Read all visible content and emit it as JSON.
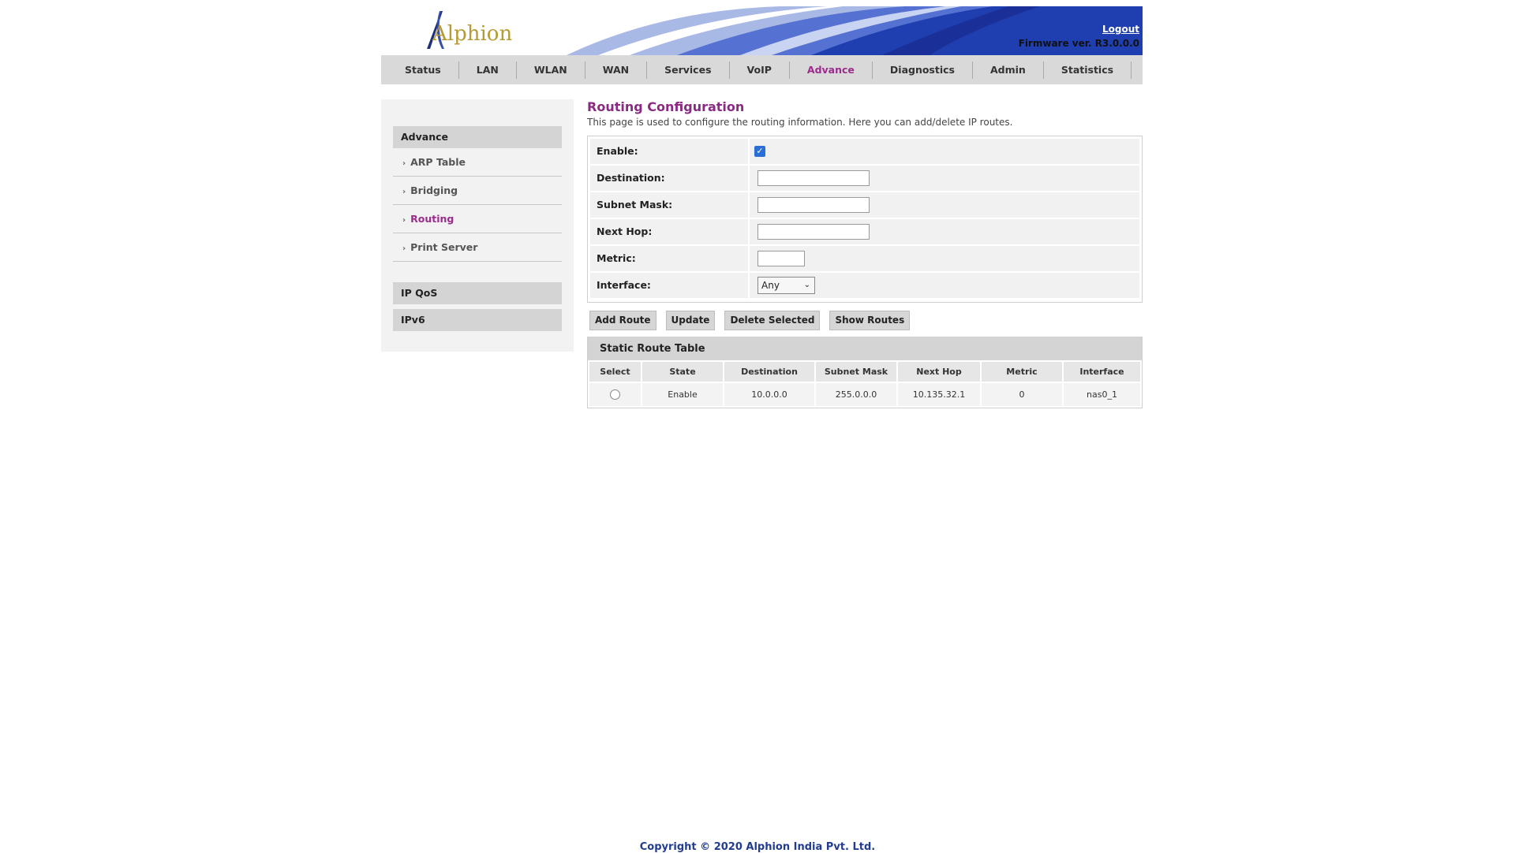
{
  "header": {
    "logo_text": "Alphion",
    "logout_label": "Logout",
    "firmware": "Firmware ver. R3.0.0.0"
  },
  "topnav": [
    {
      "label": "Status"
    },
    {
      "label": "LAN"
    },
    {
      "label": "WLAN"
    },
    {
      "label": "WAN"
    },
    {
      "label": "Services"
    },
    {
      "label": "VoIP"
    },
    {
      "label": "Advance",
      "active": true
    },
    {
      "label": "Diagnostics"
    },
    {
      "label": "Admin"
    },
    {
      "label": "Statistics"
    }
  ],
  "sidebar": {
    "section_advance": "Advance",
    "items": [
      {
        "label": "ARP Table"
      },
      {
        "label": "Bridging"
      },
      {
        "label": "Routing",
        "active": true
      },
      {
        "label": "Print Server"
      }
    ],
    "section_ipqos": "IP QoS",
    "section_ipv6": "IPv6"
  },
  "main": {
    "title": "Routing Configuration",
    "description": "This page is used to configure the routing information. Here you can add/delete IP routes.",
    "form": {
      "enable_label": "Enable:",
      "enable_checked": true,
      "destination_label": "Destination:",
      "destination_value": "",
      "subnet_label": "Subnet Mask:",
      "subnet_value": "",
      "nexthop_label": "Next Hop:",
      "nexthop_value": "",
      "metric_label": "Metric:",
      "metric_value": "",
      "interface_label": "Interface:",
      "interface_selected": "Any"
    },
    "buttons": {
      "add_route": "Add Route",
      "update": "Update",
      "delete_selected": "Delete Selected",
      "show_routes": "Show Routes"
    },
    "table": {
      "title": "Static Route Table",
      "columns": [
        "Select",
        "State",
        "Destination",
        "Subnet Mask",
        "Next Hop",
        "Metric",
        "Interface"
      ],
      "rows": [
        {
          "state": "Enable",
          "destination": "10.0.0.0",
          "subnet": "255.0.0.0",
          "nexthop": "10.135.32.1",
          "metric": "0",
          "interface": "nas0_1"
        }
      ]
    }
  },
  "footer": "Copyright © 2020 Alphion India Pvt. Ltd.",
  "colors": {
    "accent_purple": "#8b2a83",
    "nav_bg": "#d9d9d9",
    "banner_blue": "#1f3fb0",
    "footer_blue": "#223c8f"
  }
}
